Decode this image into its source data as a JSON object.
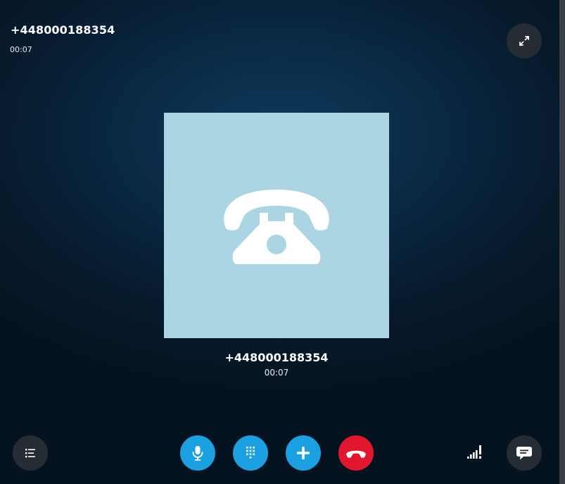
{
  "call": {
    "header_number": "+448000188354",
    "header_duration": "00:07",
    "callee_number": "+448000188354",
    "callee_duration": "00:07"
  },
  "icons": {
    "fullscreen": "expand-arrows-icon",
    "avatar": "telephone-icon",
    "menu": "list-menu-icon",
    "mic": "microphone-icon",
    "dialpad": "dialpad-icon",
    "add": "plus-icon",
    "hangup": "hang-up-phone-icon",
    "signal": "signal-strength-icon",
    "chat": "chat-bubble-icon"
  },
  "colors": {
    "avatar_bg": "#acd5e4",
    "primary_button": "#1ba0e2",
    "hangup_button": "#e2162e",
    "dark_button": "#252c33"
  }
}
